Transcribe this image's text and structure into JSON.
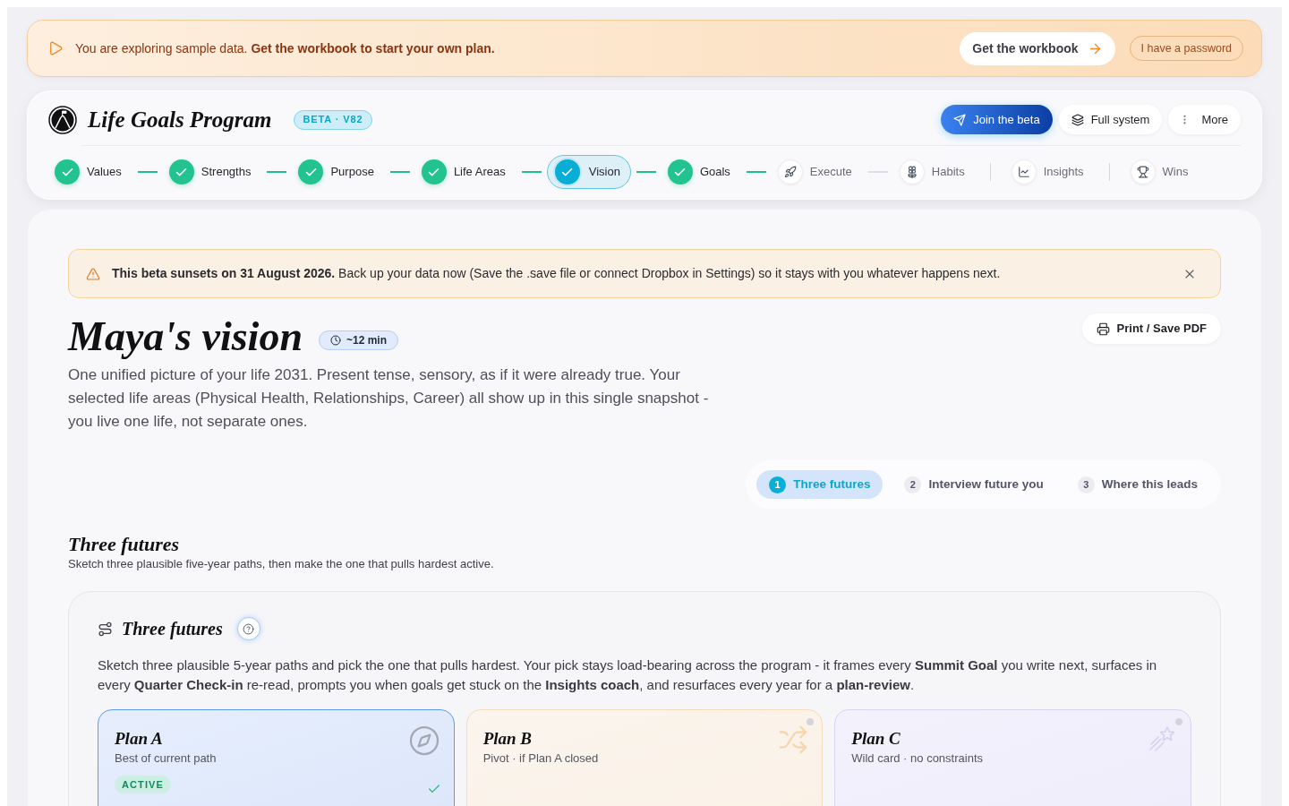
{
  "banner": {
    "text": "You are exploring sample data. **Get the workbook to start your own plan.**",
    "primary_button": "Get the workbook",
    "secondary_button": "I have a password"
  },
  "header": {
    "title": "Life Goals Program",
    "badge": "BETA · V82",
    "buttons": [
      {
        "label": "Join the beta",
        "kind": "primary"
      },
      {
        "label": "Full system",
        "kind": "secondary"
      },
      {
        "label": "More",
        "kind": "menu"
      }
    ]
  },
  "steps": [
    {
      "label": "Values",
      "done": true,
      "selected": false
    },
    {
      "label": "Strengths",
      "done": true,
      "selected": false
    },
    {
      "label": "Purpose",
      "done": true,
      "selected": false
    },
    {
      "label": "Life Areas",
      "done": true,
      "selected": false
    },
    {
      "label": "Vision",
      "done": true,
      "selected": true
    },
    {
      "label": "Goals",
      "done": true,
      "selected": false
    },
    {
      "label": "Execute",
      "done": false,
      "selected": false
    },
    {
      "label": "Habits",
      "done": false,
      "selected": false
    }
  ],
  "extra_steps": [
    {
      "label": "Insights",
      "selected": false
    },
    {
      "label": "Wins",
      "selected": false
    }
  ],
  "alert": {
    "text": "**This beta sunsets on 31 August 2026.** Back up your data now (Save the .save file or connect Dropbox in Settings) so it stays with you whatever happens next."
  },
  "page": {
    "title": "Maya's vision",
    "duration": "~12 min",
    "print_button": "Print / Save PDF",
    "description": "One unified picture of your life 2031. Present tense, sensory, as if it were already true. Your selected life areas (Physical Health, Relationships, Career) all show up in this single snapshot - you live one life, not separate ones."
  },
  "tabs": [
    {
      "number": "1",
      "label": "Three futures",
      "selected": true
    },
    {
      "number": "2",
      "label": "Interview future you",
      "selected": false
    },
    {
      "number": "3",
      "label": "Where this leads",
      "selected": false
    }
  ],
  "section": {
    "title": "Three futures",
    "subtitle": "Sketch three plausible five-year paths, then make the one that pulls hardest active."
  },
  "card": {
    "title": "Three futures",
    "text": "Sketch three plausible 5-year paths and pick the one that pulls hardest. Your pick stays load-bearing across the program - it frames every **Summit Goal** you write next, surfaces in every **Quarter Check-in** re-read, prompts you when goals get stuck on the **Insights coach**, and resurfaces every year for a **plan-review**.",
    "plans": [
      {
        "title": "Plan A",
        "subtitle": "Best of current path",
        "selected": true,
        "badge": "ACTIVE"
      },
      {
        "title": "Plan B",
        "subtitle": "Pivot · if Plan A closed",
        "selected": false
      },
      {
        "title": "Plan C",
        "subtitle": "Wild card · no constraints",
        "selected": false
      }
    ]
  }
}
